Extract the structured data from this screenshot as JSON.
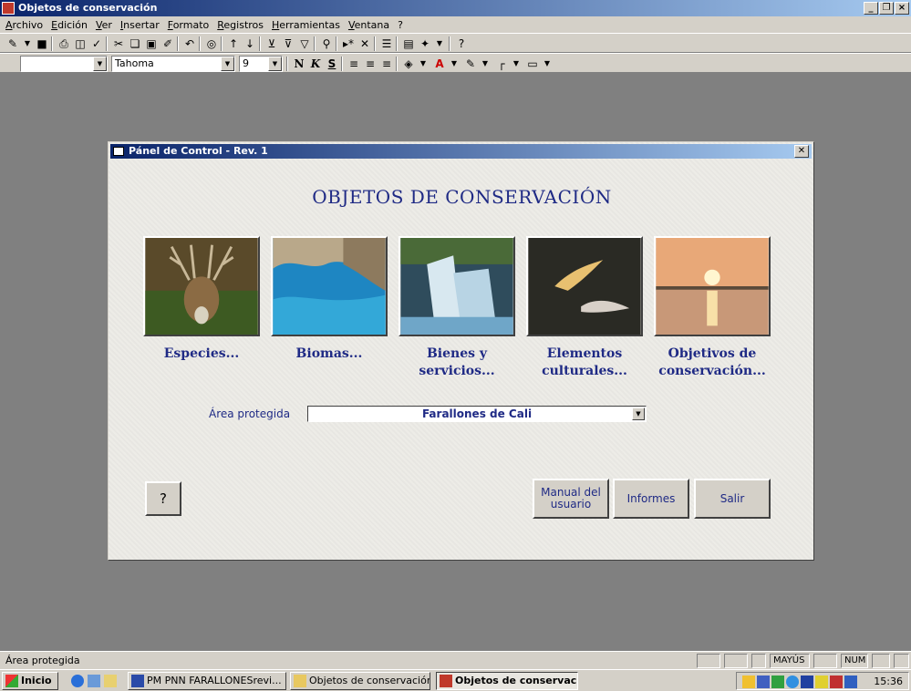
{
  "window": {
    "title": "Objetos de conservación"
  },
  "menu": [
    "Archivo",
    "Edición",
    "Ver",
    "Insertar",
    "Formato",
    "Registros",
    "Herramientas",
    "Ventana",
    "?"
  ],
  "format_toolbar": {
    "font": "Tahoma",
    "size": "9",
    "bold": "N",
    "italic": "K",
    "underline": "S"
  },
  "dialog": {
    "title": "Pánel de Control - Rev. 1",
    "heading": "OBJETOS DE CONSERVACIÓN",
    "tiles": [
      {
        "caption": "Especies...",
        "icon": "deer-photo"
      },
      {
        "caption": "Biomas...",
        "icon": "coast-photo"
      },
      {
        "caption": "Bienes y servicios...",
        "icon": "waterfall-photo"
      },
      {
        "caption": "Elementos culturales...",
        "icon": "dolphin-photo"
      },
      {
        "caption": "Objetivos de conservación...",
        "icon": "sunset-photo"
      }
    ],
    "area_label": "Área protegida",
    "area_value": "Farallones de Cali",
    "help_button": "?",
    "manual_button": "Manual del usuario",
    "reports_button": "Informes",
    "exit_button": "Salir"
  },
  "status": {
    "text": "Área protegida",
    "caps": "MAYÚS",
    "num": "NUM"
  },
  "taskbar": {
    "start": "Inicio",
    "tasks": [
      "PM PNN FARALLONESrevi...",
      "Objetos de conservación",
      "Objetos de conservaci..."
    ],
    "clock": "15:36"
  }
}
